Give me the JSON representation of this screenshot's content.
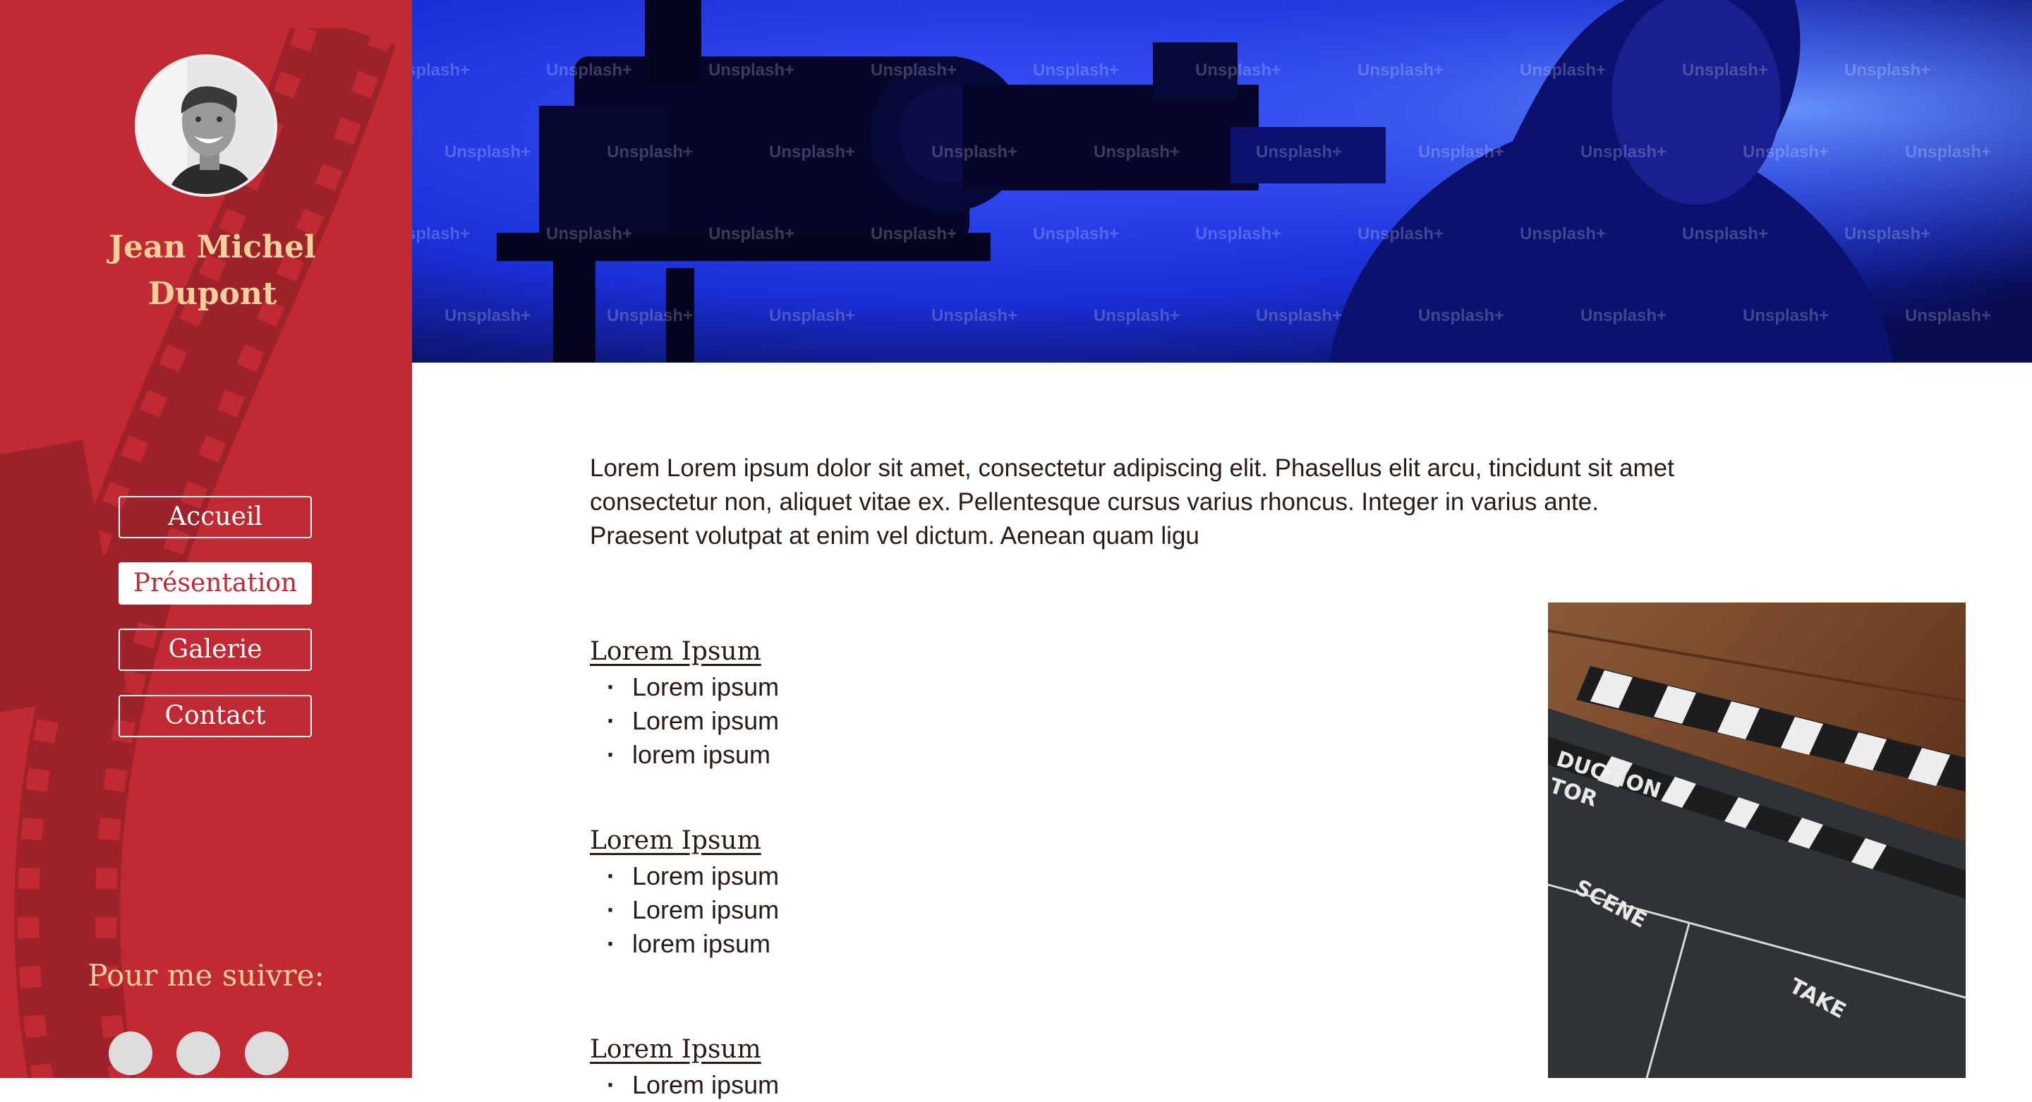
{
  "sidebar": {
    "name_line1": "Jean Michel",
    "name_line2": "Dupont",
    "nav": [
      {
        "label": "Accueil",
        "active": false
      },
      {
        "label": "Présentation",
        "active": true
      },
      {
        "label": "Galerie",
        "active": false
      },
      {
        "label": "Contact",
        "active": false
      }
    ],
    "follow_label": "Pour me suivre:",
    "social_count": 3
  },
  "banner": {
    "watermark": "Unsplash+"
  },
  "main": {
    "intro": "Lorem Lorem ipsum dolor sit amet, consectetur adipiscing elit. Phasellus elit arcu, tincidunt sit amet consectetur non, aliquet vitae ex. Pellentesque cursus varius rhoncus. Integer in varius ante. Praesent volutpat at enim vel dictum. Aenean quam ligu",
    "sections": [
      {
        "title": "Lorem Ipsum",
        "items": [
          "Lorem ipsum",
          "Lorem ipsum",
          "lorem ipsum"
        ]
      },
      {
        "title": "Lorem Ipsum",
        "items": [
          "Lorem ipsum",
          "Lorem ipsum",
          "lorem ipsum"
        ]
      },
      {
        "title": "Lorem Ipsum",
        "items": [
          "Lorem ipsum"
        ]
      }
    ]
  },
  "clapperboard": {
    "text_production": "DUCTION",
    "text_director": "TOR",
    "text_scene": "SCENE",
    "text_take": "TAKE"
  },
  "colors": {
    "sidebar_bg": "#c22a33",
    "accent_gold": "#f2cf9b",
    "banner_blue": "#1a2fd6"
  }
}
